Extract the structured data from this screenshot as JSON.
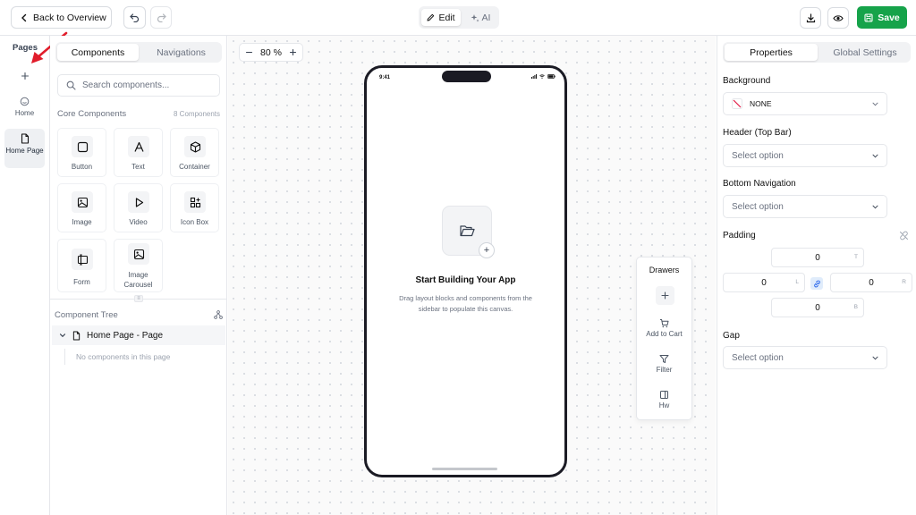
{
  "topbar": {
    "back_label": "Back to Overview",
    "mode_edit": "Edit",
    "mode_ai": "AI",
    "save_label": "Save",
    "accent_color": "#16a34a"
  },
  "pages": {
    "title": "Pages",
    "items": [
      {
        "label": "Home",
        "icon": "home-icon"
      },
      {
        "label": "Home Page",
        "icon": "file-icon",
        "active": true
      }
    ]
  },
  "components_panel": {
    "tabs": [
      "Components",
      "Navigations"
    ],
    "active_tab": "Components",
    "search_placeholder": "Search components...",
    "section_title": "Core Components",
    "section_count": "8 Components",
    "tiles": [
      {
        "label": "Button",
        "icon": "square-icon"
      },
      {
        "label": "Text",
        "icon": "text-icon"
      },
      {
        "label": "Container",
        "icon": "box-icon"
      },
      {
        "label": "Image",
        "icon": "image-icon"
      },
      {
        "label": "Video",
        "icon": "play-icon"
      },
      {
        "label": "Icon Box",
        "icon": "icon-box-icon"
      },
      {
        "label": "Form",
        "icon": "form-icon"
      },
      {
        "label": "Image Carousel",
        "icon": "carousel-icon"
      }
    ],
    "tree_title": "Component Tree",
    "tree_root": "Home Page - Page",
    "tree_empty": "No components in this page"
  },
  "canvas": {
    "zoom_value": "80",
    "zoom_unit": "%",
    "status_time": "9:41",
    "empty_title": "Start Building Your App",
    "empty_desc": "Drag layout blocks and components from the sidebar to populate this canvas."
  },
  "drawers": {
    "title": "Drawers",
    "items": [
      {
        "label": "Add to Cart",
        "icon": "cart-icon"
      },
      {
        "label": "Filter",
        "icon": "filter-icon"
      },
      {
        "label": "Hw",
        "icon": "panel-icon"
      }
    ]
  },
  "properties": {
    "tabs": [
      "Properties",
      "Global Settings"
    ],
    "active_tab": "Properties",
    "background_label": "Background",
    "background_value": "NONE",
    "header_label": "Header (Top Bar)",
    "header_value": "Select option",
    "bottom_nav_label": "Bottom Navigation",
    "bottom_nav_value": "Select option",
    "padding_label": "Padding",
    "padding": {
      "top": "0",
      "left": "0",
      "right": "0",
      "bottom": "0"
    },
    "padding_suffix": {
      "top": "T",
      "left": "L",
      "right": "R",
      "bottom": "B"
    },
    "gap_label": "Gap",
    "gap_value": "Select option"
  }
}
